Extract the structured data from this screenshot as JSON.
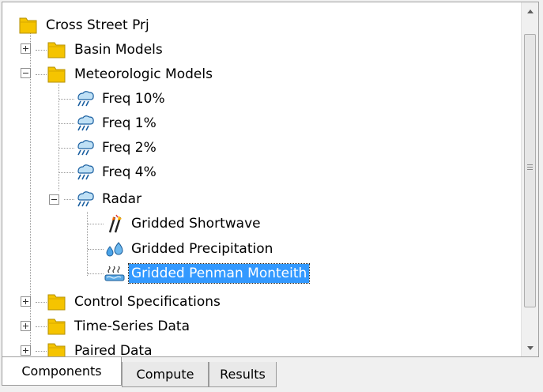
{
  "tree": {
    "root": {
      "label": "Cross Street Prj",
      "icon": "folder-icon"
    },
    "items": [
      {
        "label": "Basin Models",
        "icon": "folder-icon",
        "state": "collapsed"
      },
      {
        "label": "Meteorologic Models",
        "icon": "folder-icon",
        "state": "expanded"
      },
      {
        "label": "Freq 10%",
        "icon": "meteorologic-model-icon"
      },
      {
        "label": "Freq 1%",
        "icon": "meteorologic-model-icon"
      },
      {
        "label": "Freq 2%",
        "icon": "meteorologic-model-icon"
      },
      {
        "label": "Freq 4%",
        "icon": "meteorologic-model-icon"
      },
      {
        "label": "Radar",
        "icon": "meteorologic-model-icon",
        "state": "expanded"
      },
      {
        "label": "Gridded Shortwave",
        "icon": "shortwave-radiation-icon"
      },
      {
        "label": "Gridded Precipitation",
        "icon": "precipitation-icon"
      },
      {
        "label": "Gridded Penman Monteith",
        "icon": "evapotranspiration-icon",
        "selected": true
      },
      {
        "label": "Control Specifications",
        "icon": "folder-icon",
        "state": "collapsed"
      },
      {
        "label": "Time-Series Data",
        "icon": "folder-icon",
        "state": "collapsed"
      },
      {
        "label": "Paired Data",
        "icon": "folder-icon",
        "state": "collapsed"
      }
    ]
  },
  "tabs": [
    {
      "label": "Components",
      "active": true
    },
    {
      "label": "Compute",
      "active": false
    },
    {
      "label": "Results",
      "active": false
    }
  ],
  "colors": {
    "selection": "#3399ff",
    "folder": "#f5c400",
    "panel_border": "#a0a0a0"
  }
}
